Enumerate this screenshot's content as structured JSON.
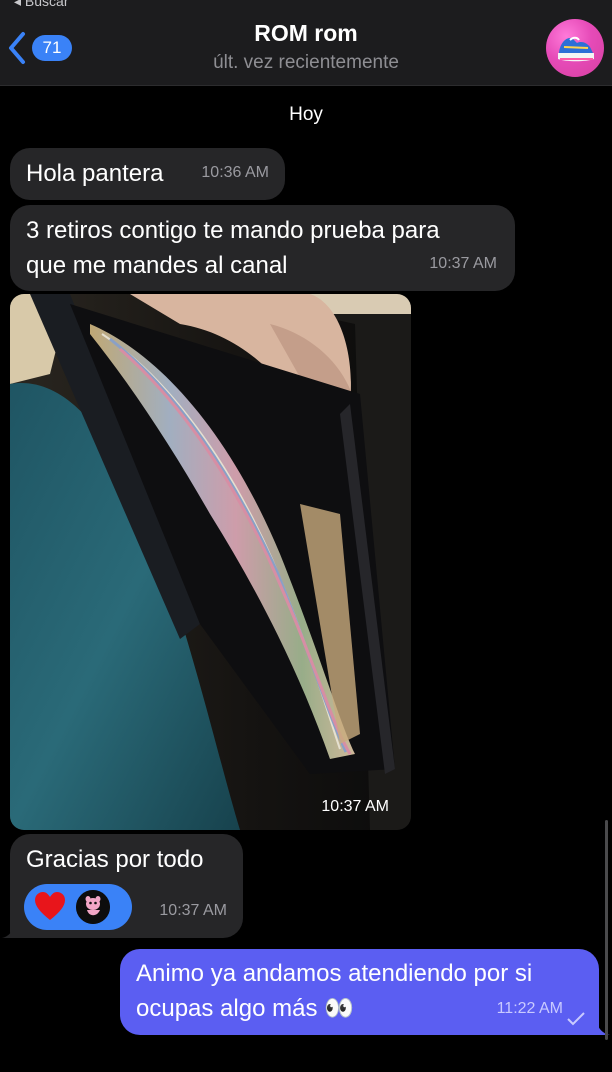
{
  "status": {
    "top_hint": "◂ Buscar"
  },
  "header": {
    "back_badge": "71",
    "title": "ROM rom",
    "subtitle": "últ. vez recientemente",
    "avatar_icon": "sneaker-avatar-icon"
  },
  "chat": {
    "date_label": "Hoy",
    "messages": [
      {
        "text": "Hola pantera",
        "time": "10:36 AM",
        "direction": "incoming"
      },
      {
        "text": "3 retiros contigo te mando prueba para\nque me mandes al canal",
        "time": "10:37 AM",
        "direction": "incoming"
      },
      {
        "type": "photo",
        "time": "10:37 AM",
        "direction": "incoming"
      },
      {
        "text": "Gracias por todo",
        "time": "10:37 AM",
        "direction": "incoming",
        "reactions": [
          "heart-icon",
          "pink-panther-avatar-icon"
        ]
      },
      {
        "text": "Animo ya andamos atendiendo por si\nocupas algo más 👀",
        "time": "11:22 AM",
        "direction": "outgoing",
        "status": "read-check-icon"
      }
    ]
  },
  "colors": {
    "incoming_bubble": "#262628",
    "outgoing_bubble": "#5b5ef2",
    "accent": "#3a82f7",
    "background": "#000000"
  }
}
